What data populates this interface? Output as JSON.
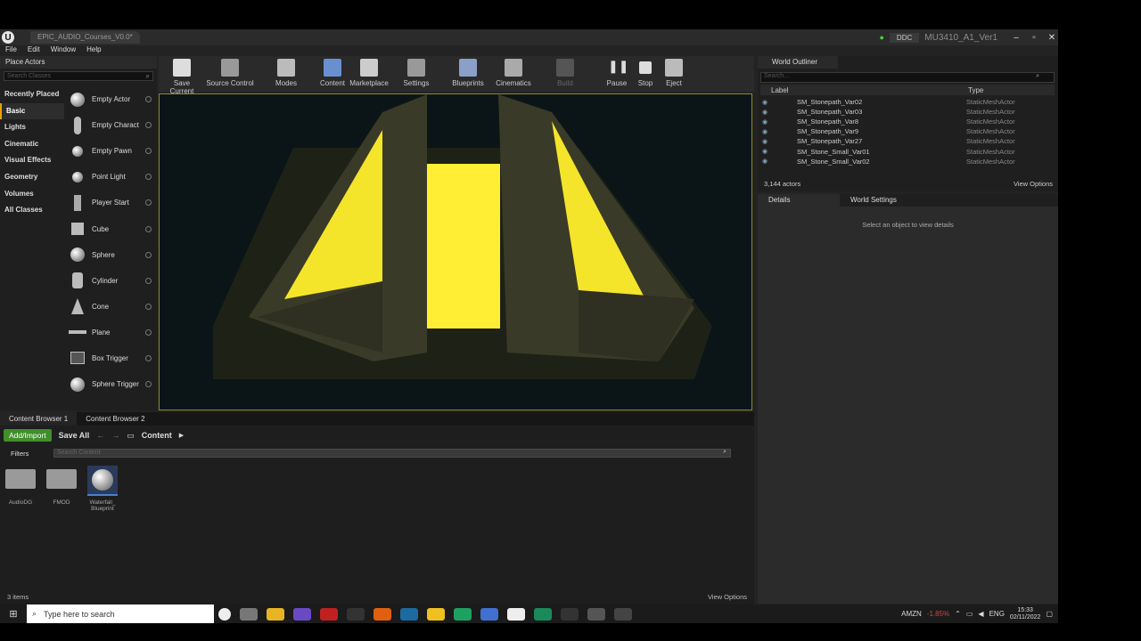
{
  "window": {
    "tab_title": "EPIC_AUDIO_Courses_V0.0*",
    "ddc": "DDC",
    "project": "MU3410_A1_Ver1"
  },
  "menu": [
    "File",
    "Edit",
    "Window",
    "Help"
  ],
  "place_actors": {
    "title": "Place Actors",
    "search_placeholder": "Search Classes",
    "categories": [
      "Recently Placed",
      "Basic",
      "Lights",
      "Cinematic",
      "Visual Effects",
      "Geometry",
      "Volumes",
      "All Classes"
    ],
    "items": [
      "Empty Actor",
      "Empty Charact",
      "Empty Pawn",
      "Point Light",
      "Player Start",
      "Cube",
      "Sphere",
      "Cylinder",
      "Cone",
      "Plane",
      "Box Trigger",
      "Sphere Trigger"
    ]
  },
  "toolbar": [
    "Save Current",
    "Source Control",
    "Modes",
    "Content",
    "Marketplace",
    "Settings",
    "Blueprints",
    "Cinematics",
    "Build",
    "Pause",
    "Stop",
    "Eject"
  ],
  "outliner": {
    "title": "World Outliner",
    "search_placeholder": "Search...",
    "col_label": "Label",
    "col_type": "Type",
    "rows": [
      {
        "label": "SM_Stonepath_Var02",
        "type": "StaticMeshActor"
      },
      {
        "label": "SM_Stonepath_Var03",
        "type": "StaticMeshActor"
      },
      {
        "label": "SM_Stonepath_Var8",
        "type": "StaticMeshActor"
      },
      {
        "label": "SM_Stonepath_Var9",
        "type": "StaticMeshActor"
      },
      {
        "label": "SM_Stonepath_Var27",
        "type": "StaticMeshActor"
      },
      {
        "label": "SM_Stone_Small_Var01",
        "type": "StaticMeshActor"
      },
      {
        "label": "SM_Stone_Small_Var02",
        "type": "StaticMeshActor"
      }
    ],
    "count": "3,144 actors",
    "view_options": "View Options"
  },
  "details": {
    "tab1": "Details",
    "tab2": "World Settings",
    "message": "Select an object to view details"
  },
  "content_browser": {
    "tab1": "Content Browser 1",
    "tab2": "Content Browser 2",
    "add": "Add/Import",
    "save_all": "Save All",
    "path": "Content",
    "filters": "Filters",
    "search_placeholder": "Search Content",
    "assets": [
      "AudioDG",
      "FMOD",
      "Waterfall_ Blueprint"
    ],
    "status": "3 items",
    "view_options": "View Options"
  },
  "taskbar": {
    "search": "Type here to search",
    "stock": "AMZN",
    "stock_change": "-1.85%",
    "lang": "ENG",
    "time": "15:33",
    "date": "02/11/2022"
  }
}
